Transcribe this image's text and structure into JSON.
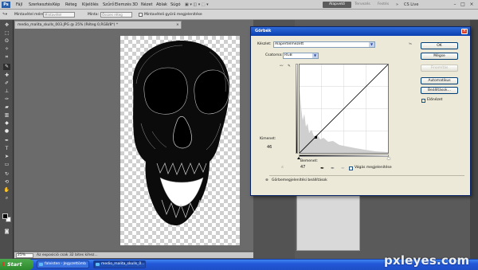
{
  "app": {
    "logo": "Ps",
    "menu": [
      "Fájl",
      "Szerkesztés",
      "Kép",
      "Réteg",
      "Kijelölés",
      "Szűrő",
      "Elemzés",
      "3D",
      "Nézet",
      "Ablak",
      "Súgó"
    ],
    "workspaces": [
      "Alapvető",
      "Tervezés",
      "Festés"
    ],
    "cs_live": "CS Live"
  },
  "options_bar": {
    "sample_size_label": "Mintavétel mérete:",
    "sample_size_value": "Mintavétel",
    "sample_label": "Minta:",
    "sample_value": "Összes réteg",
    "ring_label": "Mintavételi gyűrű megjelenítése"
  },
  "document": {
    "tab_title": "medio_malita_skulls_003.JPG @ 25% (Réteg 0,RGB/8*) *",
    "zoom": "25%",
    "status": "Az exposició csak 32 bites kihez..."
  },
  "curves_dialog": {
    "title": "Görbék",
    "preset_label": "Készlet:",
    "preset_value": "Alapértelmezett",
    "channel_label": "Csatorna:",
    "channel_value": "RGB",
    "output_label": "Kimenet:",
    "output_value": "46",
    "input_label": "Bemenet:",
    "input_value": "47",
    "clipping_label": "Vágás megjelenítése",
    "display_options_label": "Görbemegjelenítési beállítások",
    "buttons": {
      "ok": "OK",
      "cancel": "Mégse",
      "smooth": "Finomítás",
      "auto": "Automatikus",
      "options": "Beállítások..."
    },
    "preview_label": "Előnézet",
    "preview_checked": true
  },
  "taskbar": {
    "start": "Start",
    "items": [
      "falvisten - Jegyzettömb",
      "medio_malita_skulls_0..."
    ]
  },
  "watermark": "pxleyes.com"
}
